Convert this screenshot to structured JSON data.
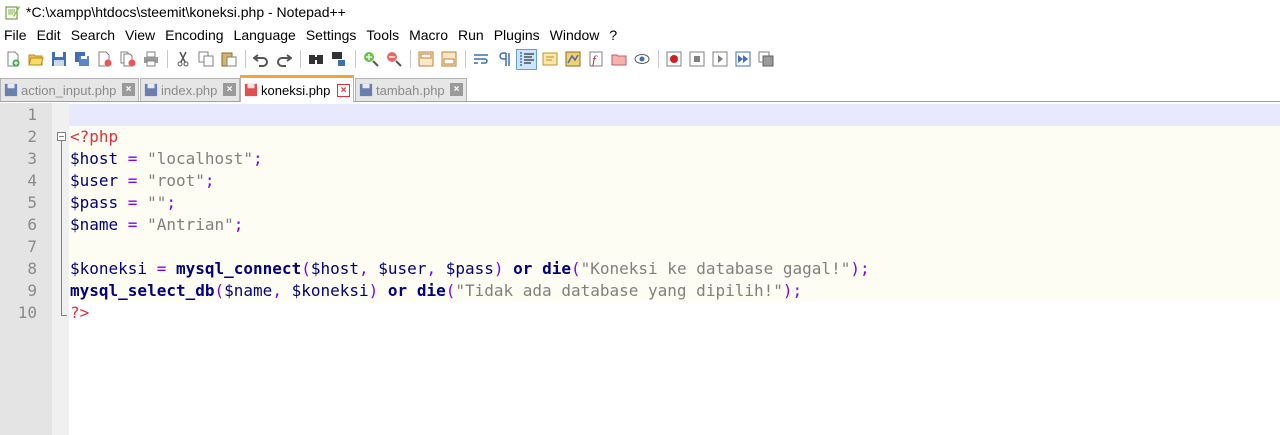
{
  "window": {
    "title": "*C:\\xampp\\htdocs\\steemit\\koneksi.php - Notepad++"
  },
  "menu": [
    "File",
    "Edit",
    "Search",
    "View",
    "Encoding",
    "Language",
    "Settings",
    "Tools",
    "Macro",
    "Run",
    "Plugins",
    "Window",
    "?"
  ],
  "toolbar": [
    "new-file-icon",
    "open-file-icon",
    "save-icon",
    "save-all-icon",
    "close-icon",
    "close-all-icon",
    "print-icon",
    "cut-icon",
    "copy-icon",
    "paste-icon",
    "undo-icon",
    "redo-icon",
    "find-icon",
    "replace-icon",
    "zoom-in-icon",
    "zoom-out-icon",
    "sync-vertical-icon",
    "sync-horizontal-icon",
    "word-wrap-icon",
    "show-all-chars-icon",
    "indent-guide-icon",
    "user-defined-language-icon",
    "document-map-icon",
    "function-list-icon",
    "folder-workspace-icon",
    "monitoring-icon",
    "record-macro-icon",
    "stop-macro-icon",
    "play-macro-icon",
    "run-macro-multiple-icon",
    "save-macro-icon"
  ],
  "tabs": [
    {
      "label": "action_input.php"
    },
    {
      "label": "index.php"
    },
    {
      "label": "koneksi.php"
    },
    {
      "label": "tambah.php"
    }
  ],
  "editor": {
    "line_numbers": [
      "1",
      "2",
      "3",
      "4",
      "5",
      "6",
      "7",
      "8",
      "9",
      "10"
    ],
    "lines": {
      "l2": {
        "tag": "<?php"
      },
      "l3": {
        "var": "$host",
        "op": " = ",
        "str": "\"localhost\"",
        "end": ";"
      },
      "l4": {
        "var": "$user",
        "op": " = ",
        "str": "\"root\"",
        "end": ";"
      },
      "l5": {
        "var": "$pass",
        "op": " = ",
        "str": "\"\"",
        "end": ";"
      },
      "l6": {
        "var": "$name",
        "op": " = ",
        "str": "\"Antrian\"",
        "end": ";"
      },
      "l8": {
        "var": "$koneksi",
        "op": " = ",
        "fn": "mysql_connect",
        "p1": "(",
        "a1": "$host",
        "c1": ", ",
        "a2": "$user",
        "c2": ", ",
        "a3": "$pass",
        "p2": ") ",
        "kw1": "or",
        "sp": " ",
        "kw2": "die",
        "p3": "(",
        "str": "\"Koneksi ke database gagal!\"",
        "p4": ");"
      },
      "l9": {
        "fn": "mysql_select_db",
        "p1": "(",
        "a1": "$name",
        "c1": ", ",
        "a2": "$koneksi",
        "p2": ") ",
        "kw1": "or",
        "sp": " ",
        "kw2": "die",
        "p3": "(",
        "str": "\"Tidak ada database yang dipilih!\"",
        "p4": ");"
      },
      "l10": {
        "tag": "?>"
      }
    }
  }
}
